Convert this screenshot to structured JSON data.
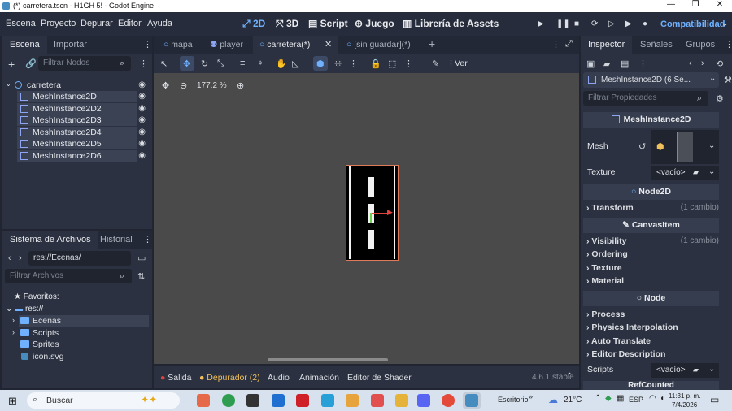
{
  "window": {
    "title": "(*) carretera.tscn - H1GH 5! - Godot Engine",
    "min": "—",
    "max": "❐",
    "close": "✕"
  },
  "menu": [
    "Escena",
    "Proyecto",
    "Depurar",
    "Editor",
    "Ayuda"
  ],
  "workspaces": {
    "w2d": "2D",
    "w3d": "3D",
    "script": "Script",
    "game": "Juego",
    "assetlib": "Librería de Assets"
  },
  "renderer": "Compatibilidad",
  "scene_dock": {
    "tabs": [
      "Escena",
      "Importar"
    ],
    "filter_placeholder": "Filtrar Nodos",
    "root": "carretera",
    "nodes": [
      "MeshInstance2D",
      "MeshInstance2D2",
      "MeshInstance2D3",
      "MeshInstance2D4",
      "MeshInstance2D5",
      "MeshInstance2D6"
    ]
  },
  "fs_dock": {
    "tabs": [
      "Sistema de Archivos",
      "Historial"
    ],
    "path": "res://Ecenas/",
    "filter_placeholder": "Filtrar Archivos",
    "favorites": "Favoritos:",
    "root": "res://",
    "items": [
      "Ecenas",
      "Scripts",
      "Sprites",
      "icon.svg"
    ]
  },
  "editor_tabs": [
    "mapa",
    "player",
    "carretera(*)",
    "[sin guardar](*)"
  ],
  "canvas": {
    "zoom": "177.2 %",
    "view_label": "Ver"
  },
  "bottom_panel": {
    "tabs": [
      "Salida",
      "Depurador (2)",
      "Audio",
      "Animación",
      "Editor de Shader"
    ],
    "version": "4.6.1.stable"
  },
  "inspector": {
    "tabs": [
      "Inspector",
      "Señales",
      "Grupos"
    ],
    "object": "MeshInstance2D (6 Se...",
    "filter_placeholder": "Filtrar Propiedades",
    "class_meshinstance": "MeshInstance2D",
    "mesh_label": "Mesh",
    "texture_label": "Texture",
    "texture_value": "<vacío>",
    "class_node2d": "Node2D",
    "transform": "Transform",
    "transform_changes": "(1 cambio)",
    "class_canvasitem": "CanvasItem",
    "visibility": "Visibility",
    "visibility_changes": "(1 cambio)",
    "ordering": "Ordering",
    "texture_section": "Texture",
    "material": "Material",
    "class_node": "Node",
    "process": "Process",
    "physics_interp": "Physics Interpolation",
    "auto_translate": "Auto Translate",
    "editor_desc": "Editor Description",
    "scripts_label": "Scripts",
    "scripts_value": "<vacío>",
    "refcounted": "RefCounted"
  },
  "taskbar": {
    "search": "Buscar",
    "escritorio": "Escritorio",
    "temp": "21°C",
    "lang": "ESP",
    "time": "11:31 p. m.",
    "date": "7/4/2026"
  },
  "colors": {
    "accent": "#6fb1ff",
    "editor_bg": "#202531",
    "panel": "#2b3140",
    "viewport": "#4a4a4a"
  }
}
